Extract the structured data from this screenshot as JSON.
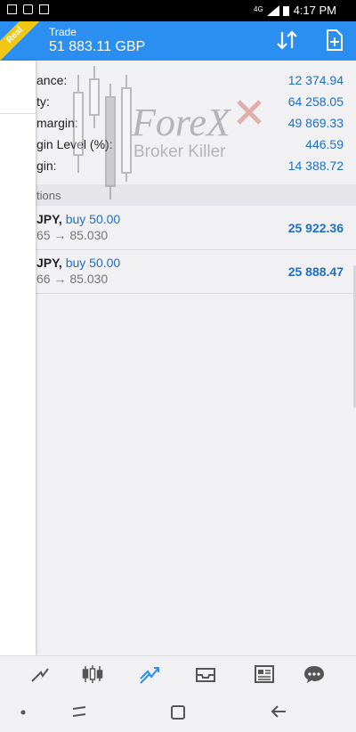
{
  "status_bar": {
    "time": "4:17 PM",
    "network": "4G"
  },
  "header": {
    "title": "Trade",
    "balance_display": "51 883.11 GBP",
    "badge": "Real",
    "sort_icon": "sort-arrows-icon",
    "new_order_icon": "new-document-icon",
    "accent_color": "#2a8ff0"
  },
  "account": {
    "rows": [
      {
        "label": "ance:",
        "value": "12 374.94"
      },
      {
        "label": "ty:",
        "value": "64 258.05"
      },
      {
        "label": "margin:",
        "value": "49 869.33"
      },
      {
        "label": "gin Level (%):",
        "value": "446.59"
      },
      {
        "label": "gin:",
        "value": "14 388.72"
      }
    ]
  },
  "positions_section": {
    "label": "tions"
  },
  "positions": [
    {
      "symbol": "JPY,",
      "direction": "buy 50.00",
      "price": "65 → 85.030",
      "profit": "25 922.36"
    },
    {
      "symbol": "JPY,",
      "direction": "buy 50.00",
      "price": "66 → 85.030",
      "profit": "25 888.47"
    }
  ],
  "watermark": {
    "line1": "ForeX",
    "line2": "Broker Killer"
  },
  "bottom_nav": {
    "items": [
      "chart-icon",
      "candlestick-icon",
      "trade-icon",
      "inbox-icon",
      "news-icon",
      "chat-icon"
    ],
    "active_color": "#2a8ff0"
  }
}
